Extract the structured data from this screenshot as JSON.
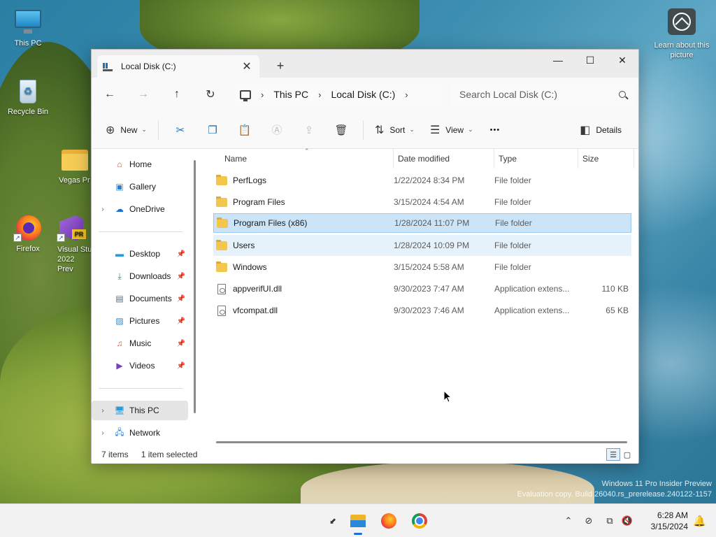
{
  "desktop": {
    "icons": [
      {
        "label": "This PC",
        "icon": "monitor-icon"
      },
      {
        "label": "Recycle Bin",
        "icon": "recycle-bin-icon"
      },
      {
        "label": "Vegas Pr",
        "icon": "folder-icon"
      },
      {
        "label": "Firefox",
        "icon": "firefox-icon"
      },
      {
        "label": "Visual Stu 2022 Prev",
        "icon": "visual-studio-icon",
        "badge": "PR"
      }
    ],
    "learn_label": "Learn about this picture",
    "watermark_line1": "Windows 11 Pro Insider Preview",
    "watermark_line2": "Evaluation copy. Build 26040.rs_prerelease.240122-1157"
  },
  "window": {
    "tab_title": "Local Disk (C:)",
    "tab_close": "✕",
    "new_tab": "+",
    "controls": {
      "minimize": "—",
      "maximize": "☐",
      "close": "✕"
    }
  },
  "nav": {
    "breadcrumb": [
      "This PC",
      "Local Disk (C:)"
    ],
    "search_placeholder": "Search Local Disk (C:)"
  },
  "toolbar": {
    "new_label": "New",
    "sort_label": "Sort",
    "view_label": "View",
    "more_label": "•••",
    "details_label": "Details"
  },
  "sidebar": {
    "quick": [
      {
        "label": "Home",
        "icon": "home-icon"
      },
      {
        "label": "Gallery",
        "icon": "gallery-icon"
      },
      {
        "label": "OneDrive",
        "icon": "onedrive-icon"
      }
    ],
    "pinned": [
      {
        "label": "Desktop",
        "icon": "desktop-icon"
      },
      {
        "label": "Downloads",
        "icon": "download-icon"
      },
      {
        "label": "Documents",
        "icon": "documents-icon"
      },
      {
        "label": "Pictures",
        "icon": "pictures-icon"
      },
      {
        "label": "Music",
        "icon": "music-icon"
      },
      {
        "label": "Videos",
        "icon": "videos-icon"
      }
    ],
    "drives": [
      {
        "label": "This PC",
        "icon": "this-pc-icon"
      },
      {
        "label": "Network",
        "icon": "network-icon"
      }
    ]
  },
  "columns": {
    "name": "Name",
    "date": "Date modified",
    "type": "Type",
    "size": "Size"
  },
  "files": [
    {
      "name": "PerfLogs",
      "date": "1/22/2024 8:34 PM",
      "type": "File folder",
      "size": "",
      "kind": "folder"
    },
    {
      "name": "Program Files",
      "date": "3/15/2024 4:54 AM",
      "type": "File folder",
      "size": "",
      "kind": "folder"
    },
    {
      "name": "Program Files (x86)",
      "date": "1/28/2024 11:07 PM",
      "type": "File folder",
      "size": "",
      "kind": "folder"
    },
    {
      "name": "Users",
      "date": "1/28/2024 10:09 PM",
      "type": "File folder",
      "size": "",
      "kind": "folder"
    },
    {
      "name": "Windows",
      "date": "3/15/2024 5:58 AM",
      "type": "File folder",
      "size": "",
      "kind": "folder"
    },
    {
      "name": "appverifUI.dll",
      "date": "9/30/2023 7:47 AM",
      "type": "Application extens...",
      "size": "110 KB",
      "kind": "file"
    },
    {
      "name": "vfcompat.dll",
      "date": "9/30/2023 7:46 AM",
      "type": "Application extens...",
      "size": "65 KB",
      "kind": "file"
    }
  ],
  "status": {
    "items": "7 items",
    "selected": "1 item selected"
  },
  "taskbar": {
    "time": "6:28 AM",
    "date": "3/15/2024"
  },
  "colors": {
    "accent": "#1a6fd0",
    "selection": "#cce4f7",
    "folder": "#f3c64e"
  }
}
